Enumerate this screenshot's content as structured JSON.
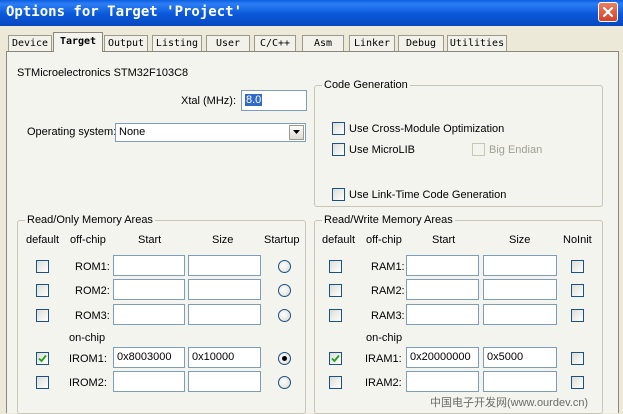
{
  "window": {
    "title": "Options for Target 'Project'"
  },
  "tabs": [
    {
      "label": "Device"
    },
    {
      "label": "Target"
    },
    {
      "label": "Output"
    },
    {
      "label": "Listing"
    },
    {
      "label": "User"
    },
    {
      "label": "C/C++"
    },
    {
      "label": "Asm"
    },
    {
      "label": "Linker"
    },
    {
      "label": "Debug"
    },
    {
      "label": "Utilities"
    }
  ],
  "device": {
    "name": "STMicroelectronics STM32F103C8"
  },
  "xtal": {
    "label": "Xtal (MHz):",
    "value": "8.0"
  },
  "os": {
    "label": "Operating system:",
    "value": "None"
  },
  "codegen": {
    "title": "Code Generation",
    "cross_module": {
      "label": "Use Cross-Module Optimization",
      "checked": false
    },
    "microlib": {
      "label": "Use MicroLIB",
      "checked": false
    },
    "big_endian": {
      "label": "Big Endian",
      "checked": false,
      "disabled": true
    },
    "ltcg": {
      "label": "Use Link-Time Code Generation",
      "checked": false
    }
  },
  "rom": {
    "title": "Read/Only Memory Areas",
    "headers": {
      "default": "default",
      "offchip": "off-chip",
      "start": "Start",
      "size": "Size",
      "last": "Startup"
    },
    "onchip_label": "on-chip",
    "rows": [
      {
        "name": "ROM1:",
        "start": "",
        "size": "",
        "default": false,
        "startup": false
      },
      {
        "name": "ROM2:",
        "start": "",
        "size": "",
        "default": false,
        "startup": false
      },
      {
        "name": "ROM3:",
        "start": "",
        "size": "",
        "default": false,
        "startup": false
      },
      {
        "name": "IROM1:",
        "start": "0x8003000",
        "size": "0x10000",
        "default": true,
        "startup": true
      },
      {
        "name": "IROM2:",
        "start": "",
        "size": "",
        "default": false,
        "startup": false
      }
    ]
  },
  "ram": {
    "title": "Read/Write Memory Areas",
    "headers": {
      "default": "default",
      "offchip": "off-chip",
      "start": "Start",
      "size": "Size",
      "last": "NoInit"
    },
    "onchip_label": "on-chip",
    "rows": [
      {
        "name": "RAM1:",
        "start": "",
        "size": "",
        "default": false,
        "noinit": false
      },
      {
        "name": "RAM2:",
        "start": "",
        "size": "",
        "default": false,
        "noinit": false
      },
      {
        "name": "RAM3:",
        "start": "",
        "size": "",
        "default": false,
        "noinit": false
      },
      {
        "name": "IRAM1:",
        "start": "0x20000000",
        "size": "0x5000",
        "default": true,
        "noinit": false
      },
      {
        "name": "IRAM2:",
        "start": "",
        "size": "",
        "default": false,
        "noinit": false
      }
    ]
  },
  "watermark": "中国电子开发网(www.ourdev.cn)"
}
